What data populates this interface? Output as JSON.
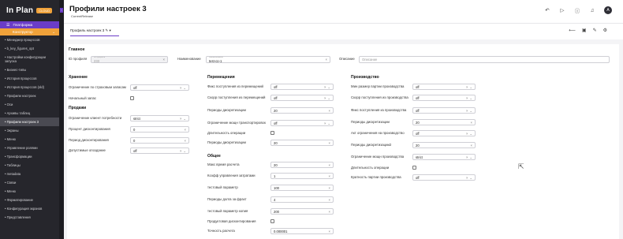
{
  "app": {
    "logo": "In Plan",
    "logo_badge": "CLOUD"
  },
  "sidebar": {
    "platform": "Платформа",
    "constructor": "Конструктор",
    "items": [
      {
        "label": "• Менеджер процессов"
      },
      {
        "label": "• b_key_figures_opt"
      },
      {
        "label": "• Настройки конфигурации запуска",
        "two": true
      },
      {
        "label": "• Бизнес-типы"
      },
      {
        "label": "• История процессов"
      },
      {
        "label": "• История процессов (old)"
      },
      {
        "label": "• Профили настроек"
      },
      {
        "label": "• Оси"
      },
      {
        "label": "• Архивы таблиц"
      },
      {
        "label": "• Профили настроек 3",
        "active": true
      },
      {
        "label": "• Экраны"
      },
      {
        "label": "• Меню"
      },
      {
        "label": "• Управление ролями"
      },
      {
        "label": "• Трансформации"
      },
      {
        "label": "• Таблицы"
      },
      {
        "label": "• metadata"
      },
      {
        "label": "• Связи"
      },
      {
        "label": "• Меню"
      },
      {
        "label": "• Форматирование"
      },
      {
        "label": "• Конфигурация экранов"
      },
      {
        "label": "• Представления"
      }
    ]
  },
  "header": {
    "title": "Профили настроек 3",
    "subtitle": "CurrentRelease",
    "avatar": "A"
  },
  "tab": {
    "label": "Профиль настроек 3 ✎ ▾"
  },
  "main": {
    "sections": {
      "main": "Главное",
      "storage": "Хранение",
      "sales": "Продажи",
      "movement": "Перемещения",
      "general": "Общее",
      "production": "Производство"
    },
    "main_fields": {
      "id_label": "ID профиля",
      "id_float": "ID профиля *",
      "id_value": "233",
      "name_label": "Наименование",
      "name_float": "Наименование *",
      "name_value": "test-cp-1",
      "desc_label": "Описание",
      "desc_placeholder": "Описание"
    },
    "storage": [
      {
        "label": "Ограничение по страховым запасам",
        "value": "off"
      },
      {
        "label": "Начальный запас",
        "type": "checkbox"
      }
    ],
    "sales": [
      {
        "label": "Ограничение клиент потребности",
        "value": "strict"
      },
      {
        "label": "Процент дисконтирования",
        "value": "0"
      },
      {
        "label": "Период дисконтирования",
        "value": "0"
      },
      {
        "label": "Допустимые опоздание",
        "value": "off"
      }
    ],
    "movement": [
      {
        "label": "Фикс поступления из перемещений",
        "value": "off"
      },
      {
        "label": "Скорр поступления из перемещений",
        "value": "off"
      },
      {
        "label": "Периоды дискретизации",
        "value": "20"
      },
      {
        "label": "Ограничение мощн транспортировок",
        "value": "off"
      },
      {
        "label": "Длительность операции",
        "type": "checkbox"
      },
      {
        "label": "Периоды дискретизации",
        "value": "20"
      }
    ],
    "general": [
      {
        "label": "Макс время расчета",
        "value": "20"
      },
      {
        "label": "Коэфф управления затратами",
        "value": "1"
      },
      {
        "label": "тестовый параметр",
        "value": "100"
      },
      {
        "label": "Периоды долга за фрахт",
        "value": "4"
      },
      {
        "label": "тестовый параметр копия",
        "value": "200"
      },
      {
        "label": "Продуктовая дисконтирования",
        "type": "checkbox"
      },
      {
        "label": "Точность расчета",
        "value": "0.000001"
      }
    ],
    "production": [
      {
        "label": "Мин размер партии производства",
        "value": "off"
      },
      {
        "label": "Скорр поступления из производства",
        "value": "off"
      },
      {
        "label": "Фикс поступления из производства",
        "value": "off"
      },
      {
        "label": "Периоды дискретизации",
        "value": "20"
      },
      {
        "label": "Акт ограничения на производство",
        "value": "off"
      },
      {
        "label": "Периоды дискретизации2",
        "value": "20"
      },
      {
        "label": "Ограничение мощн производства",
        "value": "strict"
      },
      {
        "label": "Длительность операции",
        "type": "checkbox"
      },
      {
        "label": "Кратность партии производства",
        "value": "off"
      }
    ]
  },
  "colors": {
    "accent": "#6a3cc7",
    "orange": "#f0a23a",
    "sidebar": "#26262c"
  }
}
